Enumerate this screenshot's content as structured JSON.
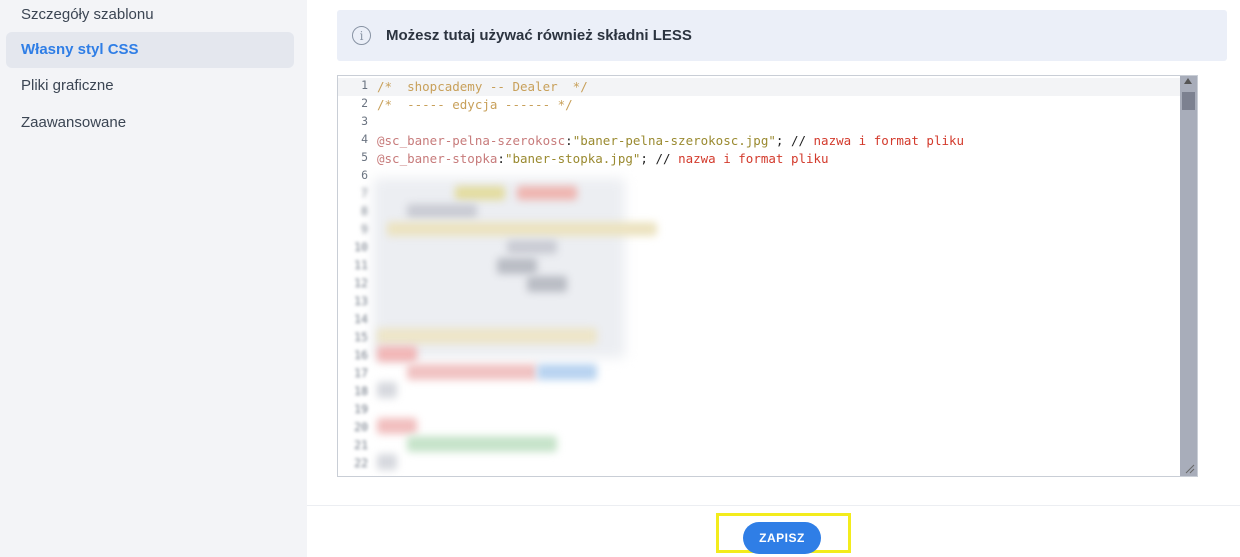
{
  "sidebar": {
    "items": [
      {
        "label": "Szczegóły szablonu",
        "active": false
      },
      {
        "label": "Własny styl CSS",
        "active": true
      },
      {
        "label": "Pliki graficzne",
        "active": false
      },
      {
        "label": "Zaawansowane",
        "active": false
      }
    ]
  },
  "info": {
    "icon": "info-circle-icon",
    "text": "Możesz tutaj używać również składni LESS"
  },
  "editor": {
    "line_numbers": [
      "1",
      "2",
      "3",
      "4",
      "5",
      "6"
    ],
    "lines": [
      {
        "comment": "/*  shopcademy -- Dealer  */"
      },
      {
        "comment": "/*  ----- edycja ------ */"
      },
      {},
      {
        "var": "@sc_baner-pelna-szerokosc",
        "sep": ":",
        "str": "\"baner-pelna-szerokosc.jpg\"",
        "semi": "; ",
        "cslash": "// ",
        "cmt": "nazwa i format pliku"
      },
      {
        "var": "@sc_baner-stopka",
        "sep": ":",
        "str": "\"baner-stopka.jpg\"",
        "semi": "; ",
        "cslash": "// ",
        "cmt": "nazwa i format pliku"
      },
      {}
    ],
    "blurred_numbers": [
      "7",
      "8",
      "9",
      "10",
      "11",
      "12",
      "13",
      "14",
      "15",
      "16",
      "17",
      "18",
      "19",
      "20",
      "21",
      "22"
    ]
  },
  "footer": {
    "save_label": "ZAPISZ"
  },
  "colors": {
    "accent": "#2f7ee6",
    "highlight": "#f3ec1c"
  }
}
